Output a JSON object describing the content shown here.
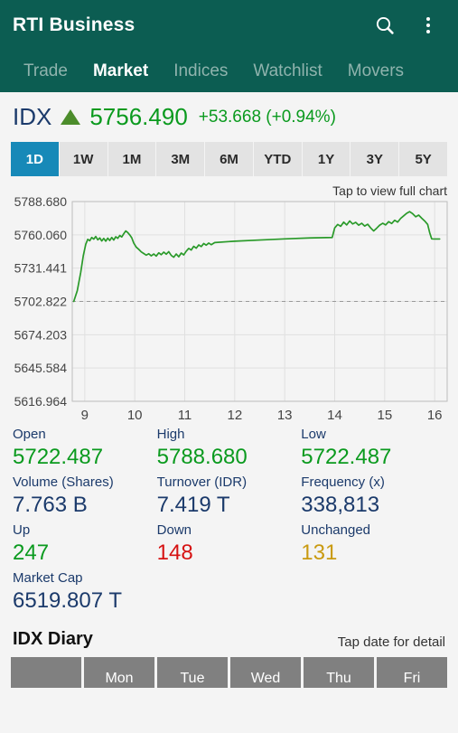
{
  "appbar": {
    "title": "RTI Business",
    "search_icon": "search-icon",
    "overflow_icon": "overflow-menu-icon"
  },
  "tabs": [
    {
      "label": "Trade",
      "active": false
    },
    {
      "label": "Market",
      "active": true
    },
    {
      "label": "Indices",
      "active": false
    },
    {
      "label": "Watchlist",
      "active": false
    },
    {
      "label": "Movers",
      "active": false
    }
  ],
  "index": {
    "name": "IDX",
    "direction_icon": "triangle-up-icon",
    "value": "5756.490",
    "change": "+53.668 (+0.94%)"
  },
  "periods": [
    {
      "label": "1D",
      "active": true
    },
    {
      "label": "1W",
      "active": false
    },
    {
      "label": "1M",
      "active": false
    },
    {
      "label": "3M",
      "active": false
    },
    {
      "label": "6M",
      "active": false
    },
    {
      "label": "YTD",
      "active": false
    },
    {
      "label": "1Y",
      "active": false
    },
    {
      "label": "3Y",
      "active": false
    },
    {
      "label": "5Y",
      "active": false
    }
  ],
  "chart_hint": "Tap to view full chart",
  "chart_data": {
    "type": "line",
    "title": "",
    "xlabel": "",
    "ylabel": "",
    "grid": true,
    "legend": "none",
    "line_color": "#2a9a2a",
    "previous_close": 5702.822,
    "previous_close_style": "dashed",
    "ylim": [
      5616.964,
      5788.68
    ],
    "yticks": [
      "5788.680",
      "5760.060",
      "5731.441",
      "5702.822",
      "5674.203",
      "5645.584",
      "5616.964"
    ],
    "ytick_values": [
      5788.68,
      5760.06,
      5731.441,
      5702.822,
      5674.203,
      5645.584,
      5616.964
    ],
    "xlim": [
      8.75,
      16.25
    ],
    "xticks": [
      "9",
      "10",
      "11",
      "12",
      "13",
      "14",
      "15",
      "16"
    ],
    "xtick_values": [
      9,
      10,
      11,
      12,
      13,
      14,
      15,
      16
    ],
    "x": [
      8.78,
      8.85,
      8.92,
      8.97,
      9.02,
      9.06,
      9.1,
      9.14,
      9.18,
      9.22,
      9.26,
      9.3,
      9.34,
      9.38,
      9.42,
      9.46,
      9.5,
      9.54,
      9.58,
      9.62,
      9.66,
      9.7,
      9.74,
      9.78,
      9.82,
      9.86,
      9.9,
      9.94,
      9.98,
      10.03,
      10.08,
      10.13,
      10.18,
      10.23,
      10.28,
      10.33,
      10.38,
      10.43,
      10.48,
      10.53,
      10.58,
      10.63,
      10.68,
      10.73,
      10.78,
      10.83,
      10.88,
      10.93,
      10.98,
      11.03,
      11.08,
      11.13,
      11.18,
      11.23,
      11.28,
      11.33,
      11.38,
      11.43,
      11.48,
      11.53,
      11.6,
      12.0,
      12.5,
      13.0,
      13.5,
      13.95,
      14.0,
      14.06,
      14.12,
      14.18,
      14.24,
      14.3,
      14.36,
      14.42,
      14.48,
      14.54,
      14.6,
      14.66,
      14.72,
      14.78,
      14.84,
      14.9,
      14.96,
      15.02,
      15.08,
      15.14,
      15.2,
      15.26,
      15.32,
      15.38,
      15.44,
      15.5,
      15.56,
      15.62,
      15.68,
      15.74,
      15.8,
      15.86,
      15.9,
      15.94,
      16.0,
      16.1
    ],
    "y": [
      5702.822,
      5712.0,
      5728.0,
      5742.0,
      5752.0,
      5756.2,
      5755.0,
      5757.8,
      5756.4,
      5758.6,
      5755.8,
      5757.4,
      5754.8,
      5757.0,
      5754.6,
      5757.2,
      5755.2,
      5757.8,
      5755.6,
      5758.4,
      5757.0,
      5759.5,
      5758.2,
      5761.0,
      5763.4,
      5762.0,
      5760.0,
      5757.5,
      5753.0,
      5749.5,
      5747.6,
      5745.4,
      5744.0,
      5742.6,
      5743.8,
      5742.0,
      5743.6,
      5741.8,
      5744.6,
      5743.0,
      5745.2,
      5743.4,
      5745.6,
      5742.4,
      5740.8,
      5743.6,
      5741.2,
      5744.4,
      5742.8,
      5746.0,
      5748.4,
      5747.0,
      5750.2,
      5748.6,
      5751.4,
      5750.0,
      5752.6,
      5751.2,
      5753.0,
      5751.6,
      5753.4,
      5754.6,
      5755.6,
      5756.6,
      5757.4,
      5757.8,
      5766.0,
      5769.0,
      5767.4,
      5771.0,
      5768.6,
      5772.0,
      5769.4,
      5770.8,
      5768.4,
      5770.0,
      5767.6,
      5769.2,
      5766.0,
      5763.4,
      5765.8,
      5768.4,
      5770.0,
      5768.6,
      5771.4,
      5769.8,
      5772.6,
      5771.0,
      5774.2,
      5776.4,
      5778.6,
      5780.0,
      5778.2,
      5775.6,
      5777.0,
      5774.4,
      5772.0,
      5769.0,
      5762.0,
      5756.6,
      5756.49,
      5756.49
    ]
  },
  "stats": [
    [
      {
        "label": "Open",
        "value": "5722.487",
        "color": "green"
      },
      {
        "label": "High",
        "value": "5788.680",
        "color": "green"
      },
      {
        "label": "Low",
        "value": "5722.487",
        "color": "green"
      }
    ],
    [
      {
        "label": "Volume (Shares)",
        "value": "7.763 B",
        "color": "navy"
      },
      {
        "label": "Turnover (IDR)",
        "value": "7.419 T",
        "color": "navy"
      },
      {
        "label": "Frequency (x)",
        "value": "338,813",
        "color": "navy"
      }
    ],
    [
      {
        "label": "Up",
        "value": "247",
        "color": "up"
      },
      {
        "label": "Down",
        "value": "148",
        "color": "down"
      },
      {
        "label": "Unchanged",
        "value": "131",
        "color": "unch"
      }
    ],
    [
      {
        "label": "Market Cap",
        "value": "6519.807 T",
        "color": "navy"
      },
      {
        "label": "",
        "value": "",
        "color": "navy"
      },
      {
        "label": "",
        "value": "",
        "color": "navy"
      }
    ]
  ],
  "diary": {
    "title": "IDX Diary",
    "hint": "Tap date for detail",
    "columns": [
      "",
      "Mon",
      "Tue",
      "Wed",
      "Thu",
      "Fri"
    ]
  }
}
